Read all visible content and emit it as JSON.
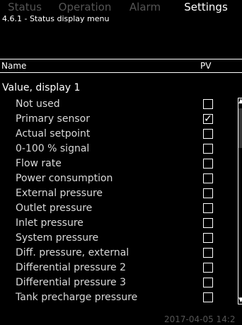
{
  "tabs": [
    {
      "label": "Status",
      "active": false
    },
    {
      "label": "Operation",
      "active": false
    },
    {
      "label": "Alarm",
      "active": false
    },
    {
      "label": "Settings",
      "active": true
    }
  ],
  "breadcrumb": "4.6.1 - Status display menu",
  "table_header": {
    "name": "Name",
    "pv": "PV"
  },
  "group_label": "Value, display 1",
  "options": [
    {
      "label": "Not used",
      "checked": false
    },
    {
      "label": "Primary sensor",
      "checked": true
    },
    {
      "label": "Actual setpoint",
      "checked": false
    },
    {
      "label": "0-100 % signal",
      "checked": false
    },
    {
      "label": "Flow rate",
      "checked": false
    },
    {
      "label": "Power consumption",
      "checked": false
    },
    {
      "label": "External pressure",
      "checked": false
    },
    {
      "label": "Outlet pressure",
      "checked": false
    },
    {
      "label": "Inlet pressure",
      "checked": false
    },
    {
      "label": "System pressure",
      "checked": false
    },
    {
      "label": "Diff. pressure, external",
      "checked": false
    },
    {
      "label": "Differential pressure 2",
      "checked": false
    },
    {
      "label": "Differential pressure 3",
      "checked": false
    },
    {
      "label": "Tank precharge pressure",
      "checked": false
    }
  ],
  "checkmark_glyph": "✓",
  "scroll": {
    "up_glyph": "▲",
    "down_glyph": "▼"
  },
  "footer_time": "2017-04-05 14:2",
  "colors": {
    "background": "#000000",
    "text": "#ffffff",
    "inactive_tab": "#555555"
  }
}
